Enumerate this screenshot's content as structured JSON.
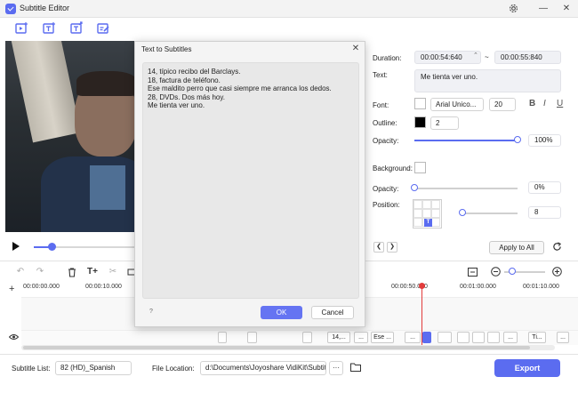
{
  "window": {
    "title": "Subtitle Editor",
    "settings_icon": "gear-icon",
    "minimize": "—",
    "close": "✕"
  },
  "toolbar": {
    "icons": [
      "import-video-icon",
      "add-subtitle-icon",
      "export-subtitle-icon",
      "edit-subtitle-icon"
    ]
  },
  "player": {
    "play_icon": "play-icon",
    "progress_percent": 17
  },
  "timeline": {
    "ticks": [
      "00:00:00.000",
      "00:00:10.000",
      "00:00:50.000",
      "00:01:00.000",
      "00:01:10.000"
    ],
    "segments": [
      "",
      "",
      "",
      "14,...",
      "...",
      "Ese ...",
      "...",
      "",
      "",
      "",
      "",
      "...",
      "Ti...",
      "..."
    ],
    "zoom_percent": 20
  },
  "panel": {
    "duration_label": "Duration:",
    "duration_start": "00:00:54:640",
    "duration_tilde": "~",
    "duration_end": "00:00:55:840",
    "text_label": "Text:",
    "text_value": "Me tienta ver uno.",
    "font_label": "Font:",
    "font_name": "Arial Unico...",
    "font_size": "20",
    "font_styles": [
      "B",
      "I",
      "U"
    ],
    "outline_label": "Outline:",
    "outline_value": "2",
    "opacity_label": "Opacity:",
    "opacity_value": "100%",
    "opacity_level": 100,
    "background_label": "Background:",
    "bg_opacity_label": "Opacity:",
    "bg_opacity_value": "0%",
    "bg_opacity_level": 0,
    "position_label": "Position:",
    "position_value": "8",
    "position_marker": "T",
    "apply_label": "Apply to All",
    "colors": {
      "font_color": "#ffffff",
      "outline_color": "#000000",
      "accent": "#5b6cf0"
    }
  },
  "footer": {
    "subtitle_list_label": "Subtitle List:",
    "subtitle_list_value": "82 (HD)_Spanish",
    "file_location_label": "File Location:",
    "file_location_value": "d:\\Documents\\Joyoshare VidiKit\\Subtitle",
    "more_label": "···",
    "export_label": "Export"
  },
  "dialog": {
    "title": "Text to Subtitles",
    "close": "✕",
    "content": "14, típico recibo del Barclays.\n18, factura de teléfono.\nEse maldito perro que casi siempre me arranca los dedos.\n28, DVDs. Dos más hoy.\nMe tienta ver uno.",
    "help": "?",
    "ok_label": "OK",
    "cancel_label": "Cancel"
  }
}
